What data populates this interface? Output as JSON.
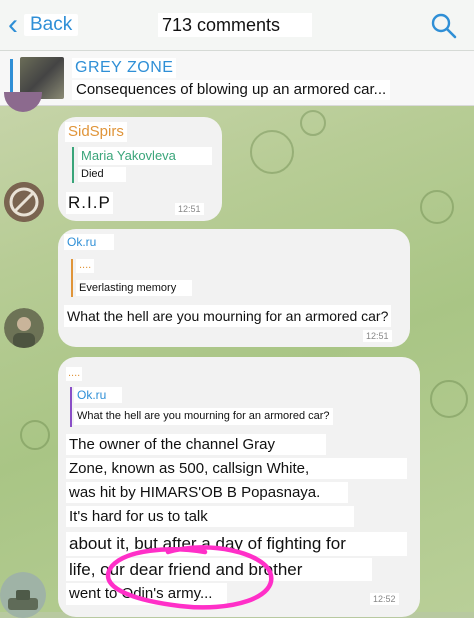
{
  "header": {
    "back_label": "Back",
    "title": "713 comments"
  },
  "pinned": {
    "channel": "GREY ZONE",
    "text": "Consequences of blowing up an armored car..."
  },
  "messages": [
    {
      "sender": "SidSpirs",
      "quote_author": "Maria Yakovleva",
      "quote_text": "Died",
      "text": "R.I.P",
      "time": "12:51"
    },
    {
      "sender": "Ok.ru",
      "quote_author": "....",
      "quote_text": "Everlasting memory",
      "text": "What the hell are you mourning for an armored car?",
      "time": "12:51"
    },
    {
      "sender": "....",
      "quote_author": "Ok.ru",
      "quote_text": "What the hell are you mourning for an armored car?",
      "lines": [
        "The owner of the channel Gray",
        "Zone, known as 500, callsign White,",
        "was hit by HIMARS'OB B Popasnaya.",
        "It's hard for us to talk",
        "about it, but after a day of fighting for",
        "life, our dear friend and brother",
        "went to Odin's army..."
      ],
      "time": "12:52"
    }
  ],
  "colors": {
    "accent": "#2f8fd6",
    "sender_orange": "#e0953a",
    "quote_purple": "#8a4fc7",
    "annotation": "#ff2fc8"
  }
}
